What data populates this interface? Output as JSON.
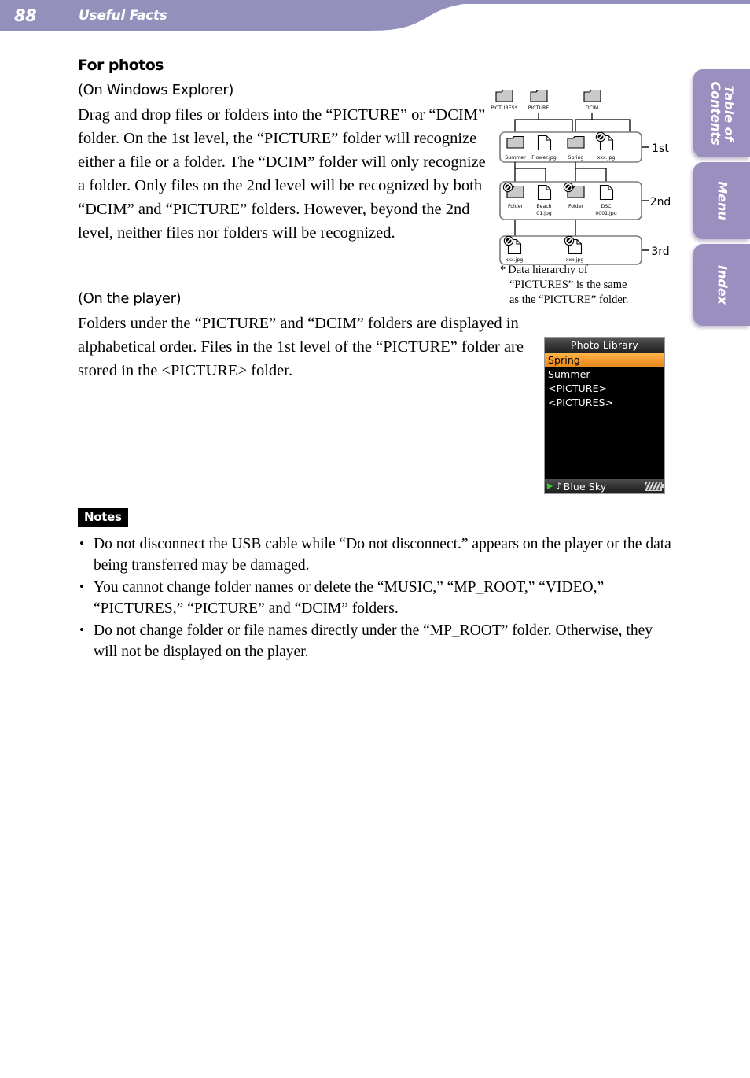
{
  "header": {
    "page_number": "88",
    "section_title": "Useful Facts",
    "banner_color": "#9490bc"
  },
  "side_tabs": [
    {
      "id": "table-of-contents",
      "label_line1": "Table of",
      "label_line2": "Contents"
    },
    {
      "id": "menu",
      "label_line1": "Menu",
      "label_line2": ""
    },
    {
      "id": "index",
      "label_line1": "Index",
      "label_line2": ""
    }
  ],
  "tab_color": "#9b8fc0",
  "main": {
    "heading": "For photos",
    "explorer": {
      "subhead": "(On Windows Explorer)",
      "paragraph": "Drag and drop files or folders into the “PICTURE” or “DCIM” folder. On the 1st level, the “PICTURE” folder will recognize either a file or a folder. The “DCIM” folder will only recognize a folder. Only files on the 2nd level will be recognized by both “DCIM” and “PICTURE” folders. However, beyond the 2nd level, neither files nor folders will be recognized."
    },
    "player": {
      "subhead": "(On the player)",
      "paragraph": "Folders under the “PICTURE” and “DCIM” folders are displayed in alphabetical order. Files in the 1st level of the “PICTURE” folder are stored in the <PICTURE> folder."
    }
  },
  "notes": {
    "badge": "Notes",
    "items": [
      "Do not disconnect the USB cable while “Do not disconnect.” appears on the player or the data being transferred may be damaged.",
      "You cannot change folder names or delete the “MUSIC,” “MP_ROOT,” “VIDEO,” “PICTURES,” “PICTURE” and “DCIM” folders.",
      "Do not change folder or file names directly under the “MP_ROOT” folder. Otherwise, they will not be displayed on the player."
    ]
  },
  "diagram": {
    "roots": [
      {
        "name": "PICTURES*",
        "type": "folder"
      },
      {
        "name": "PICTURE",
        "type": "folder"
      },
      {
        "name": "DCIM",
        "type": "folder"
      }
    ],
    "levels": [
      {
        "label": "1st",
        "items": [
          {
            "name": "Summer",
            "type": "folder",
            "blocked": false
          },
          {
            "name": "Flower.jpg",
            "type": "file",
            "blocked": false
          },
          {
            "name": "Spring",
            "type": "folder",
            "blocked": false
          },
          {
            "name": "xxx.jpg",
            "type": "file",
            "blocked": true
          }
        ]
      },
      {
        "label": "2nd",
        "items": [
          {
            "name": "Folder",
            "type": "folder",
            "blocked": true
          },
          {
            "name": "Beach 01.jpg",
            "type": "file",
            "blocked": false
          },
          {
            "name": "Folder",
            "type": "folder",
            "blocked": true
          },
          {
            "name": "DSC 0001.jpg",
            "type": "file",
            "blocked": false
          }
        ]
      },
      {
        "label": "3rd",
        "items": [
          {
            "name": "xxx.jpg",
            "type": "file",
            "blocked": true
          },
          {
            "name": "xxx.jpg",
            "type": "file",
            "blocked": true
          }
        ]
      }
    ],
    "footnote": {
      "marker": "*",
      "line1": "Data hierarchy of",
      "line2": "“PICTURES” is the same",
      "line3": "as the “PICTURE” folder."
    }
  },
  "player_screen": {
    "title": "Photo Library",
    "items": [
      {
        "label": "Spring",
        "selected": true
      },
      {
        "label": "Summer",
        "selected": false
      },
      {
        "label": "<PICTURE>",
        "selected": false
      },
      {
        "label": "<PICTURES>",
        "selected": false
      }
    ],
    "status": {
      "play_state": "play-icon",
      "track": "Blue Sky",
      "battery": "battery-icon"
    },
    "highlight_color": "#f2972b"
  }
}
